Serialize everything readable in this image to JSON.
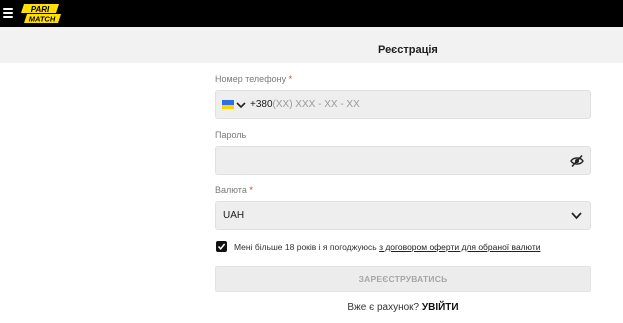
{
  "header": {
    "menu_icon": "hamburger-icon",
    "logo_text": "PARIMATCH"
  },
  "page": {
    "title": "Реєстрація"
  },
  "form": {
    "phone": {
      "label": "Номер телефону",
      "required_mark": "*",
      "flag_icon": "ukraine-flag-icon",
      "prefix": "+380",
      "placeholder": "(XX) XXX - XX - XX"
    },
    "password": {
      "label": "Пароль",
      "value": "",
      "visibility_icon": "eye-off-icon"
    },
    "currency": {
      "label": "Валюта",
      "required_mark": "*",
      "selected": "UAH"
    },
    "agreement": {
      "checked": true,
      "text": "Мені більше 18 років і я погоджуюсь ",
      "link_text": "з договором оферти для обраної валюти"
    },
    "submit_label": "ЗАРЕЄСТРУВАТИСЬ"
  },
  "footer": {
    "have_account_text": "Вже є рахунок?",
    "login_label": "УВІЙТИ"
  },
  "colors": {
    "topbar": "#000000",
    "logo_yellow": "#ffe000",
    "required": "#e0392f",
    "field_bg": "#eeeeee"
  }
}
